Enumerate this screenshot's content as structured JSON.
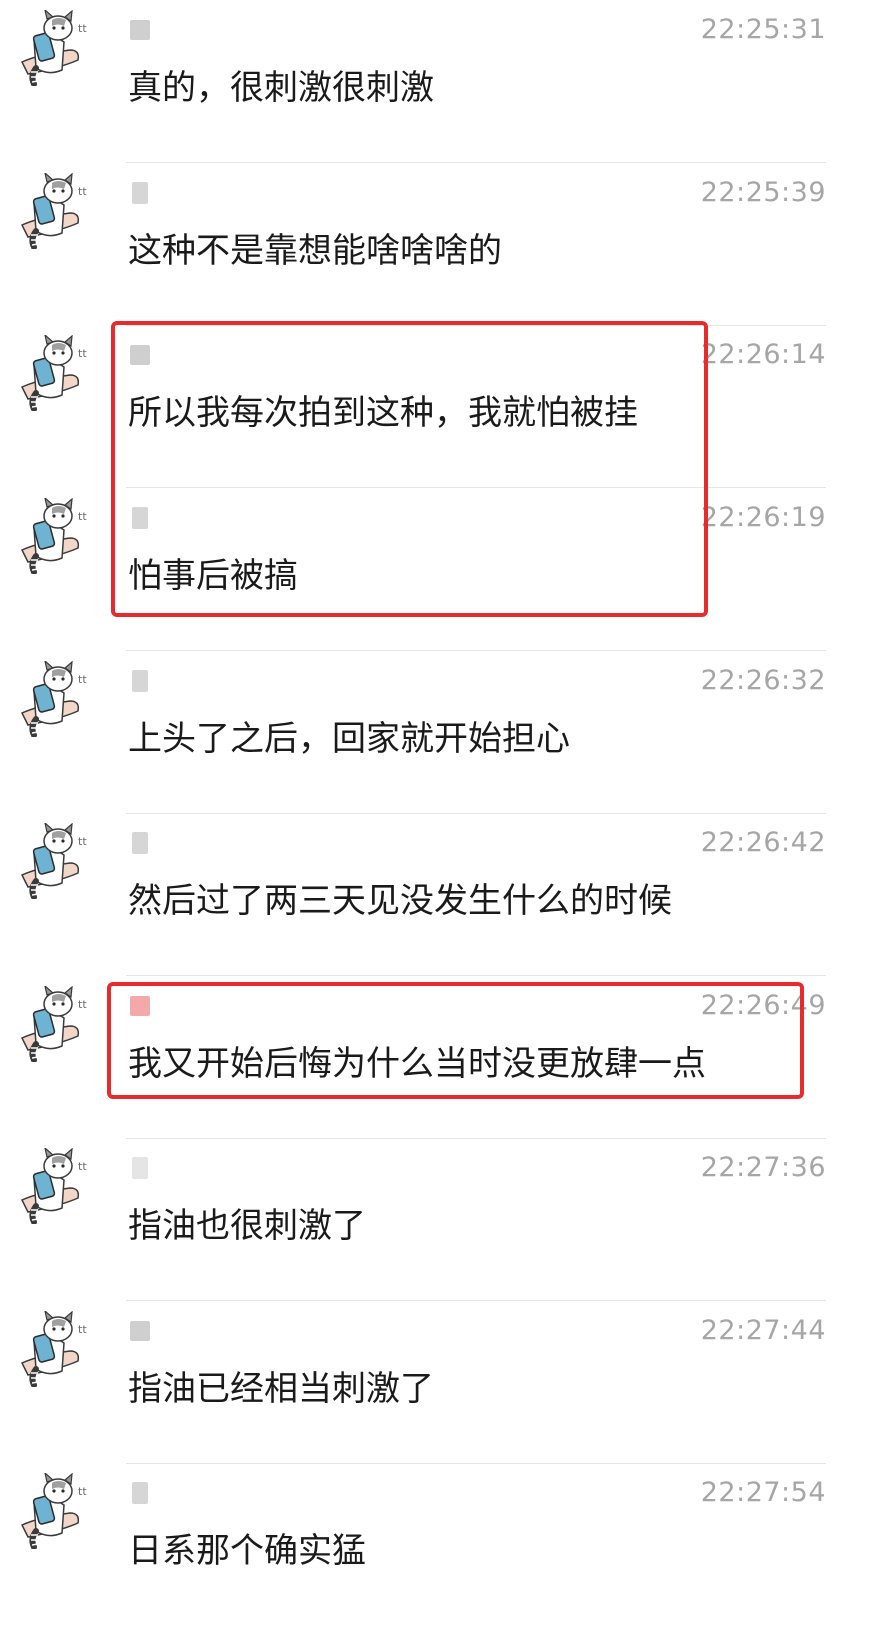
{
  "messages": [
    {
      "time": "22:25:31",
      "text": "真的，很刺激很刺激"
    },
    {
      "time": "22:25:39",
      "text": "这种不是靠想能啥啥啥的"
    },
    {
      "time": "22:26:14",
      "text": "所以我每次拍到这种，我就怕被挂"
    },
    {
      "time": "22:26:19",
      "text": "怕事后被搞"
    },
    {
      "time": "22:26:32",
      "text": "上头了之后，回家就开始担心"
    },
    {
      "time": "22:26:42",
      "text": "然后过了两三天见没发生什么的时候"
    },
    {
      "time": "22:26:49",
      "text": "我又开始后悔为什么当时没更放肆一点"
    },
    {
      "time": "22:27:36",
      "text": "指油也很刺激了"
    },
    {
      "time": "22:27:44",
      "text": "指油已经相当刺激了"
    },
    {
      "time": "22:27:54",
      "text": "日系那个确实猛"
    }
  ],
  "colors": {
    "highlight": "#ea2a2a",
    "time": "#a6a6a6",
    "text": "#1a1a1a",
    "divider": "#e6e6e6"
  },
  "icons": {
    "avatar": "cat-sticker-avatar"
  }
}
